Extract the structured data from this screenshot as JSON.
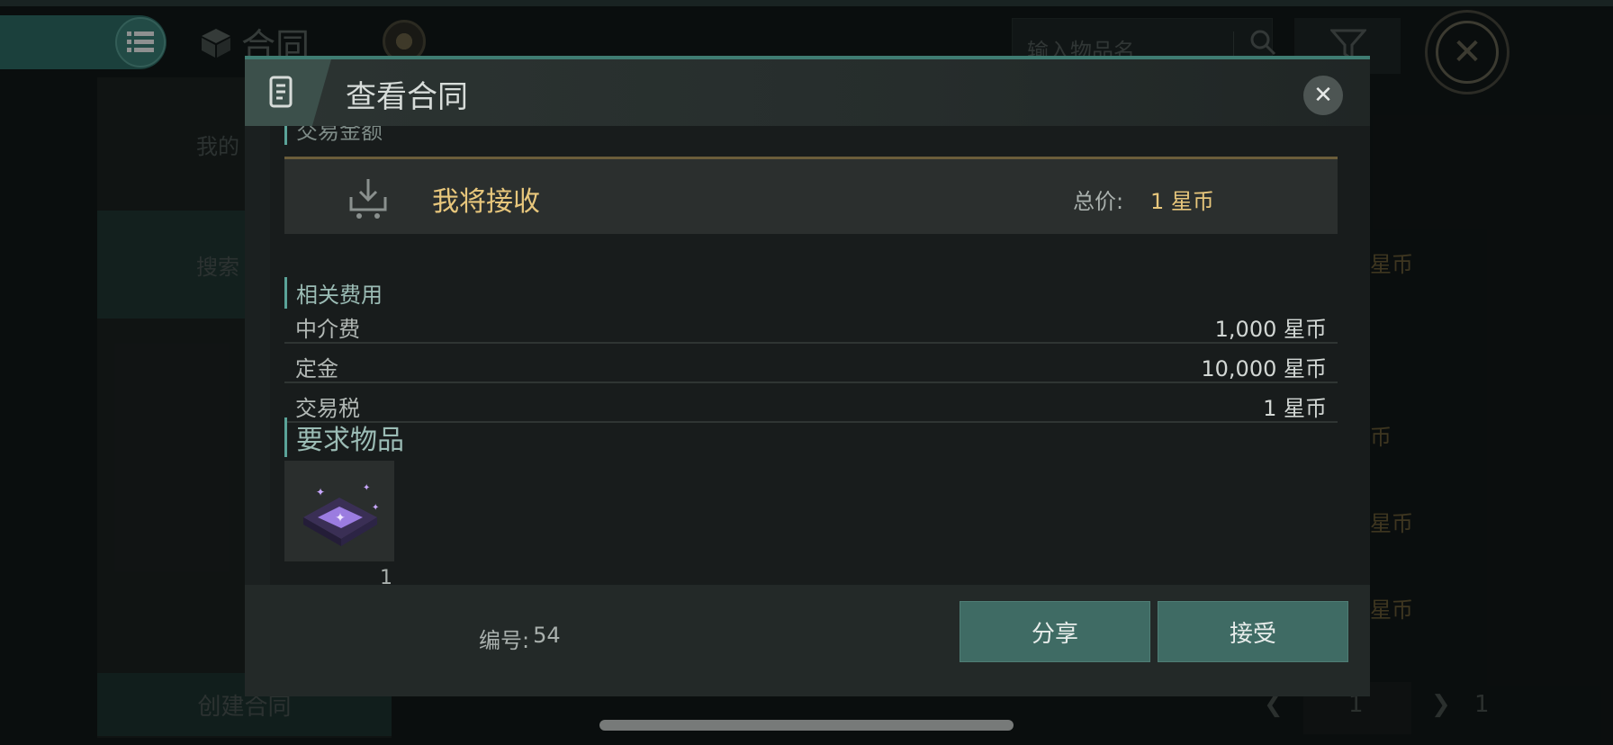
{
  "background": {
    "title": "合同",
    "search_placeholder": "输入物品名",
    "sidebar": {
      "my_label": "我的",
      "search_label": "搜索",
      "create_label": "创建合同"
    },
    "list_values": [
      "星币",
      "币",
      "星币",
      "星币"
    ],
    "pager": {
      "current": "1",
      "total": "1"
    }
  },
  "modal": {
    "title": "查看合同",
    "cut_heading": "交易金额",
    "receive": {
      "label": "我将接收",
      "total_label": "总价:",
      "total_value": "1 星币"
    },
    "fees": {
      "heading": "相关费用",
      "rows": [
        {
          "name": "中介费",
          "value": "1,000 星币"
        },
        {
          "name": "定金",
          "value": "10,000 星币"
        },
        {
          "name": "交易税",
          "value": "1 星币"
        }
      ]
    },
    "required_items": {
      "heading": "要求物品",
      "items": [
        {
          "icon": "purple-chip-icon",
          "quantity": "1"
        }
      ]
    },
    "serial": {
      "label": "编号:",
      "value": "54"
    },
    "buttons": {
      "share": "分享",
      "accept": "接受"
    }
  },
  "colors": {
    "accent": "#3f6b64",
    "gold": "#e8c77c",
    "panel": "#1b2020"
  }
}
